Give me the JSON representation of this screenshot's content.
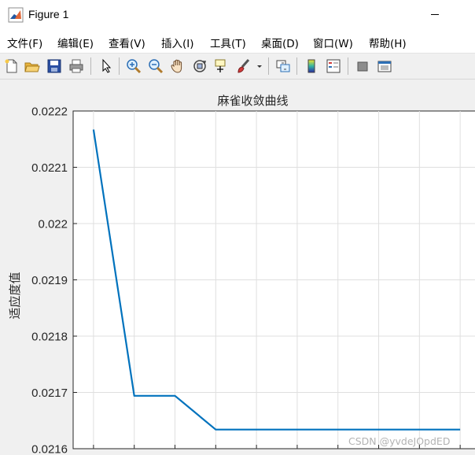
{
  "window": {
    "title": "Figure 1"
  },
  "menu": [
    "文件(F)",
    "编辑(E)",
    "查看(V)",
    "插入(I)",
    "工具(T)",
    "桌面(D)",
    "窗口(W)",
    "帮助(H)"
  ],
  "toolbar_icons": [
    "new-figure-icon",
    "open-folder-icon",
    "save-icon",
    "print-icon",
    "pointer-arrow-icon",
    "zoom-in-icon",
    "zoom-out-icon",
    "pan-hand-icon",
    "rotate-3d-icon",
    "data-cursor-icon",
    "brush-icon",
    "brush-dropdown-icon",
    "link-plot-icon",
    "colorbar-icon",
    "legend-icon",
    "hide-plot-tools-icon",
    "show-plot-tools-icon"
  ],
  "chart_data": {
    "type": "line",
    "title": "麻雀收敛曲线",
    "xlabel": "",
    "ylabel": "适应度值",
    "ylim": [
      0.0216,
      0.0222
    ],
    "y_ticks": [
      "0.0216",
      "0.0217",
      "0.0218",
      "0.0219",
      "0.022",
      "0.0221",
      "0.0222"
    ],
    "x": [
      1,
      2,
      3,
      4,
      5,
      6,
      7,
      8,
      9,
      10
    ],
    "series": [
      {
        "values": [
          0.022167,
          0.021694,
          0.021694,
          0.021634,
          0.021634,
          0.021634,
          0.021634,
          0.021634,
          0.021634,
          0.021634
        ]
      }
    ],
    "line_color": "#0072BD",
    "grid": true
  },
  "watermark": "CSDN @yvdeJOpdED"
}
